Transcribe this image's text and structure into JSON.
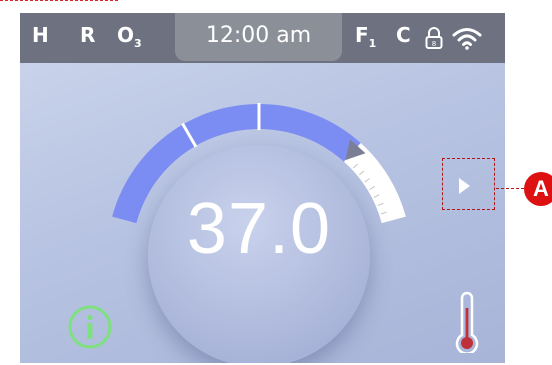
{
  "status": {
    "indicators": [
      "H",
      "R",
      "O",
      "F",
      "C"
    ],
    "o_subscript": "3",
    "f_subscript": "1",
    "time": "12:00 am"
  },
  "main": {
    "temperature": "37.0",
    "setpoint_fraction": 0.78
  },
  "callout": {
    "label": "A"
  },
  "colors": {
    "screen_bg": "#b8c4e2",
    "status_bar": "#6d7180",
    "gauge_fill": "#7b8cf2",
    "info_icon": "#7ee07e",
    "thermo_icon": "#c0303a",
    "callout": "#dd1111"
  },
  "icons": [
    "lock-icon",
    "wifi-icon",
    "info-icon",
    "thermometer-icon",
    "arrow-right-icon"
  ]
}
